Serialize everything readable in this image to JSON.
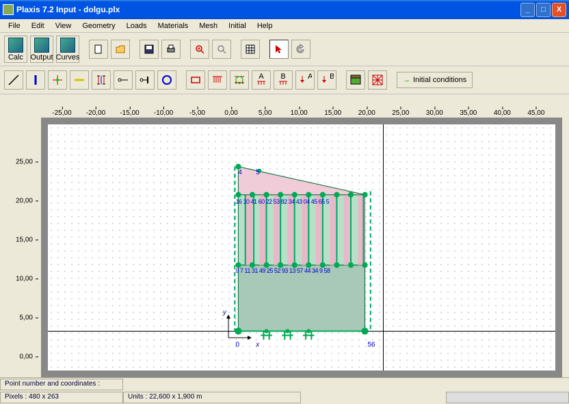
{
  "window": {
    "title": "Plaxis 7.2 Input - dolgu.plx"
  },
  "menu": {
    "items": [
      "File",
      "Edit",
      "View",
      "Geometry",
      "Loads",
      "Materials",
      "Mesh",
      "Initial",
      "Help"
    ]
  },
  "toolbar1": {
    "calc": "Calc",
    "output": "Output",
    "curves": "Curves"
  },
  "toolbar2": {
    "initial_conditions": "Initial conditions"
  },
  "ruler_h": {
    "ticks": [
      "-25,00",
      "-20,00",
      "-15,00",
      "-10,00",
      "-5,00",
      "0,00",
      "5,00",
      "10,00",
      "15,00",
      "20,00",
      "25,00",
      "30,00",
      "35,00",
      "40,00",
      "45,00"
    ]
  },
  "ruler_v": {
    "ticks": [
      "25,00",
      "20,00",
      "15,00",
      "10,00",
      "5,00",
      "0,00"
    ]
  },
  "geometry": {
    "node_labels_top": [
      "4",
      "5"
    ],
    "node_labels_mid1": "16 10 41 60 22 53 82 34 43 04 45 65 5",
    "node_labels_mid2": "9 7 11 31 49 25 52 93 13 57 44 34 9 58",
    "node_label_bl": "0",
    "node_label_br": "56",
    "axis_x": "x",
    "axis_y": "y"
  },
  "status": {
    "hint": "Point number and coordinates :",
    "pixels": "Pixels : 480 x 263",
    "units": "Units  : 22,600 x 1,900 m"
  }
}
